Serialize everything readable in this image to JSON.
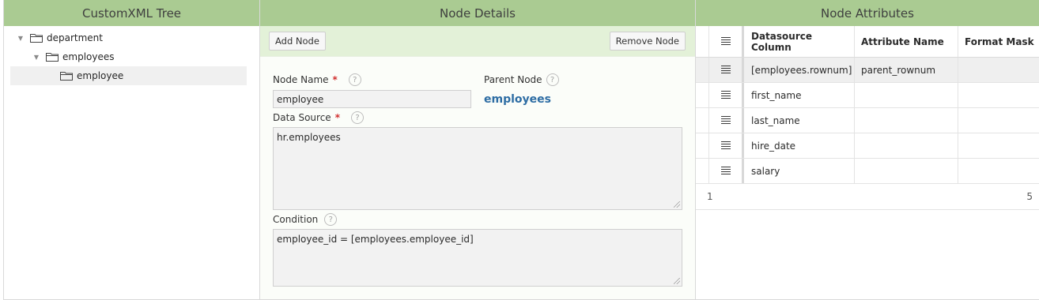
{
  "tree_panel": {
    "title": "CustomXML Tree",
    "nodes": [
      {
        "label": "department"
      },
      {
        "label": "employees"
      },
      {
        "label": "employee"
      }
    ]
  },
  "details_panel": {
    "title": "Node Details",
    "add_node_label": "Add Node",
    "remove_node_label": "Remove Node",
    "node_name_label": "Node Name",
    "node_name_value": "employee",
    "parent_node_label": "Parent Node",
    "parent_node_value": "employees",
    "data_source_label": "Data Source",
    "data_source_value": "hr.employees",
    "condition_label": "Condition",
    "condition_value": "employee_id = [employees.employee_id]",
    "required_marker": "*",
    "help_glyph": "?"
  },
  "attributes_panel": {
    "title": "Node Attributes",
    "columns": [
      "Datasource Column",
      "Attribute Name",
      "Format Mask"
    ],
    "rows": [
      {
        "datasource_column": "[employees.rownum]",
        "attribute_name": "parent_rownum",
        "format_mask": ""
      },
      {
        "datasource_column": "first_name",
        "attribute_name": "",
        "format_mask": ""
      },
      {
        "datasource_column": "last_name",
        "attribute_name": "",
        "format_mask": ""
      },
      {
        "datasource_column": "hire_date",
        "attribute_name": "",
        "format_mask": ""
      },
      {
        "datasource_column": "salary",
        "attribute_name": "",
        "format_mask": ""
      }
    ],
    "footer_start": "1",
    "footer_end": "5"
  },
  "colors": {
    "header_green": "#aacb92",
    "toolbar_green": "#e3f1d8",
    "parent_link_blue": "#2e6da4",
    "required_red": "#d12e2e"
  },
  "icons": [
    "folder-icon",
    "chevron-down-icon",
    "help-icon",
    "row-menu-icon",
    "resize-grip-icon"
  ]
}
